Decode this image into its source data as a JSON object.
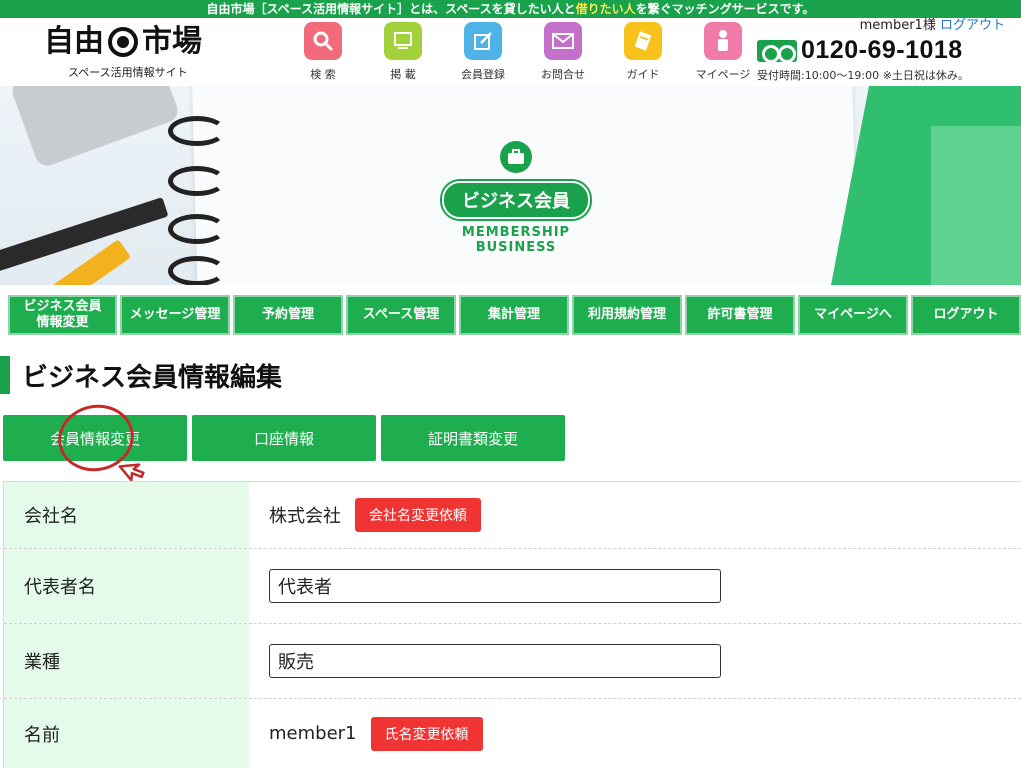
{
  "top_banner": {
    "text_before": "自由市場［スペース活用情報サイト］とは、スペースを貸したい人と",
    "highlight": "借りたい人",
    "text_after": "を繋ぐマッチングサービスです。"
  },
  "logo": {
    "title_left": "自由",
    "title_right": "市場",
    "subtitle": "スペース活用情報サイト"
  },
  "nav_icons": [
    {
      "label": "検 索",
      "color": "#f26b7a",
      "icon": "search-icon"
    },
    {
      "label": "掲 載",
      "color": "#a2d13c",
      "icon": "monitor-icon"
    },
    {
      "label": "会員登録",
      "color": "#4fb3e8",
      "icon": "edit-icon"
    },
    {
      "label": "お問合せ",
      "color": "#c46fc9",
      "icon": "mail-icon"
    },
    {
      "label": "ガイド",
      "color": "#f7c21b",
      "icon": "guide-icon"
    },
    {
      "label": "マイページ",
      "color": "#f07aa8",
      "icon": "person-icon"
    }
  ],
  "header_right": {
    "member": "member1様",
    "logout_link": "ログアウト",
    "phone": "0120-69-1018",
    "hours": "受付時間:10:00～19:00 ※土日祝は休み。"
  },
  "hero": {
    "badge": "ビジネス会員",
    "subtitle": "MEMBERSHIP BUSINESS"
  },
  "menu": [
    {
      "line1": "ビジネス会員",
      "line2": "情報変更"
    },
    {
      "line1": "メッセージ管理",
      "line2": ""
    },
    {
      "line1": "予約管理",
      "line2": ""
    },
    {
      "line1": "スペース管理",
      "line2": ""
    },
    {
      "line1": "集計管理",
      "line2": ""
    },
    {
      "line1": "利用規約管理",
      "line2": ""
    },
    {
      "line1": "許可書管理",
      "line2": ""
    },
    {
      "line1": "マイページへ",
      "line2": ""
    },
    {
      "line1": "ログアウト",
      "line2": ""
    }
  ],
  "page_title": "ビジネス会員情報編集",
  "tabs": [
    "会員情報変更",
    "口座情報",
    "証明書類変更"
  ],
  "form": {
    "company": {
      "label": "会社名",
      "value": "株式会社",
      "button": "会社名変更依頼"
    },
    "representative": {
      "label": "代表者名",
      "value": "代表者"
    },
    "industry": {
      "label": "業種",
      "value": "販売"
    },
    "name": {
      "label": "名前",
      "value": "member1",
      "button": "氏名変更依頼"
    }
  },
  "colors": {
    "brand_green": "#1aa14b",
    "menu_green": "#1fae4f",
    "label_bg": "#e4fbec",
    "request_red": "#f03434",
    "annotation_red": "#c52a2a"
  }
}
